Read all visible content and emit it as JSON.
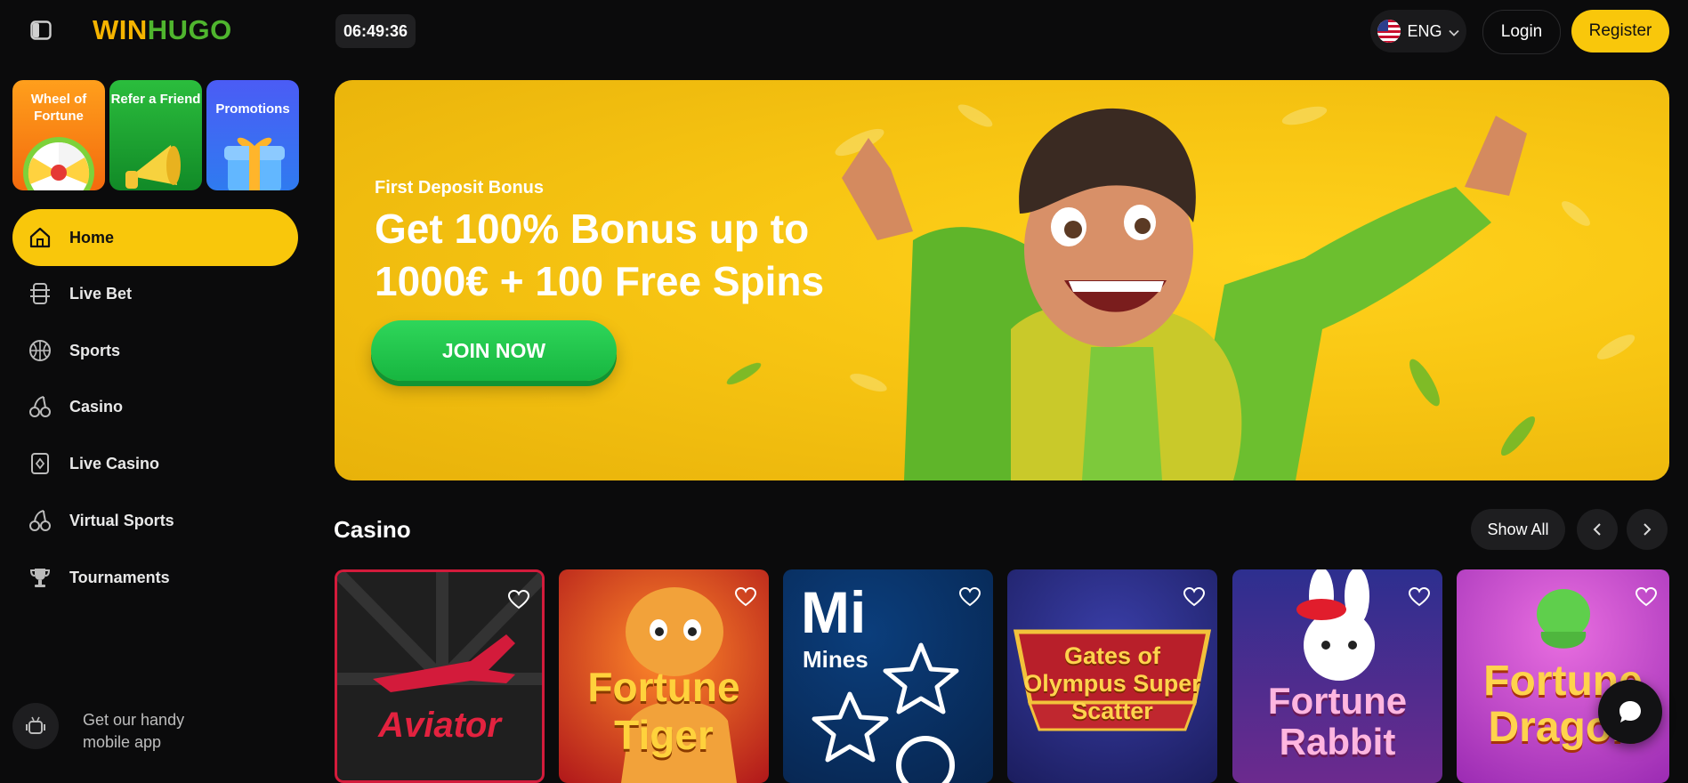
{
  "header": {
    "logo_part1": "WIN",
    "logo_part2": "HUGO",
    "clock": "06:49:36",
    "language": "ENG",
    "login_label": "Login",
    "register_label": "Register"
  },
  "promos": [
    {
      "label": "Wheel of Fortune",
      "icon": "wheel-icon"
    },
    {
      "label": "Refer a Friend",
      "icon": "megaphone-icon"
    },
    {
      "label": "Promotions",
      "icon": "gift-icon"
    }
  ],
  "nav": [
    {
      "label": "Home",
      "icon": "home-icon",
      "active": true
    },
    {
      "label": "Live Bet",
      "icon": "live-bet-icon"
    },
    {
      "label": "Sports",
      "icon": "basketball-icon"
    },
    {
      "label": "Casino",
      "icon": "cherry-icon"
    },
    {
      "label": "Live Casino",
      "icon": "card-icon"
    },
    {
      "label": "Virtual Sports",
      "icon": "cherry-icon"
    },
    {
      "label": "Tournaments",
      "icon": "trophy-icon"
    }
  ],
  "app_promo": "Get our handy mobile app",
  "banner": {
    "subtitle": "First Deposit Bonus",
    "title": "Get 100% Bonus up to 1000€ + 100 Free Spins",
    "cta": "JOIN NOW"
  },
  "casino": {
    "title": "Casino",
    "show_all": "Show All",
    "games": [
      {
        "name": "Aviator"
      },
      {
        "name": "Fortune Tiger"
      },
      {
        "name": "Mines",
        "badge": "Mi"
      },
      {
        "name": "Gates of Olympus Super Scatter"
      },
      {
        "name": "Fortune Rabbit"
      },
      {
        "name": "Fortune Dragon"
      }
    ]
  },
  "colors": {
    "accent": "#f9c70b",
    "join_green": "#22c94c",
    "background": "#0b0b0c"
  }
}
